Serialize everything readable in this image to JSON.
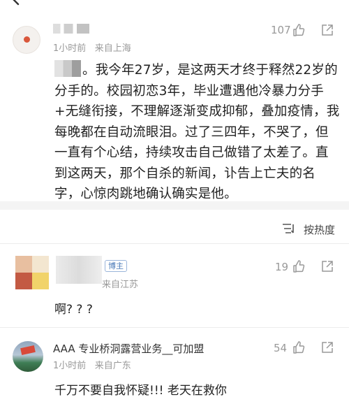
{
  "comment1": {
    "timestamp": "1小时前",
    "location": "来自上海",
    "like_count": "107",
    "text": "。我今年27岁，是这两天才终于释然22岁的分手的。校园初恋3年，毕业遭遇他冷暴力分手+无缝衔接，不理解逐渐变成抑郁，叠加疫情，我每晚都在自动流眼泪。过了三四年，不哭了，但一直有个心结，持续攻击自己做错了太差了。直到这两天，那个自杀的新闻，讣告上亡夫的名字，心惊肉跳地确认确实是他。"
  },
  "sort": {
    "label": "按热度"
  },
  "reply1": {
    "badge": "博主",
    "location": "来自江苏",
    "like_count": "19",
    "text": "啊? ? ?"
  },
  "reply2": {
    "username": "AAA 专业桥洞露营业务__可加盟",
    "timestamp": "1小时前",
    "location": "来自广东",
    "like_count": "54",
    "text": "千万不要自我怀疑!!! 老天在救你"
  },
  "icons": {
    "back": "back-arrow-icon",
    "like": "thumbs-up-icon",
    "share": "share-icon",
    "sort": "sort-icon"
  }
}
